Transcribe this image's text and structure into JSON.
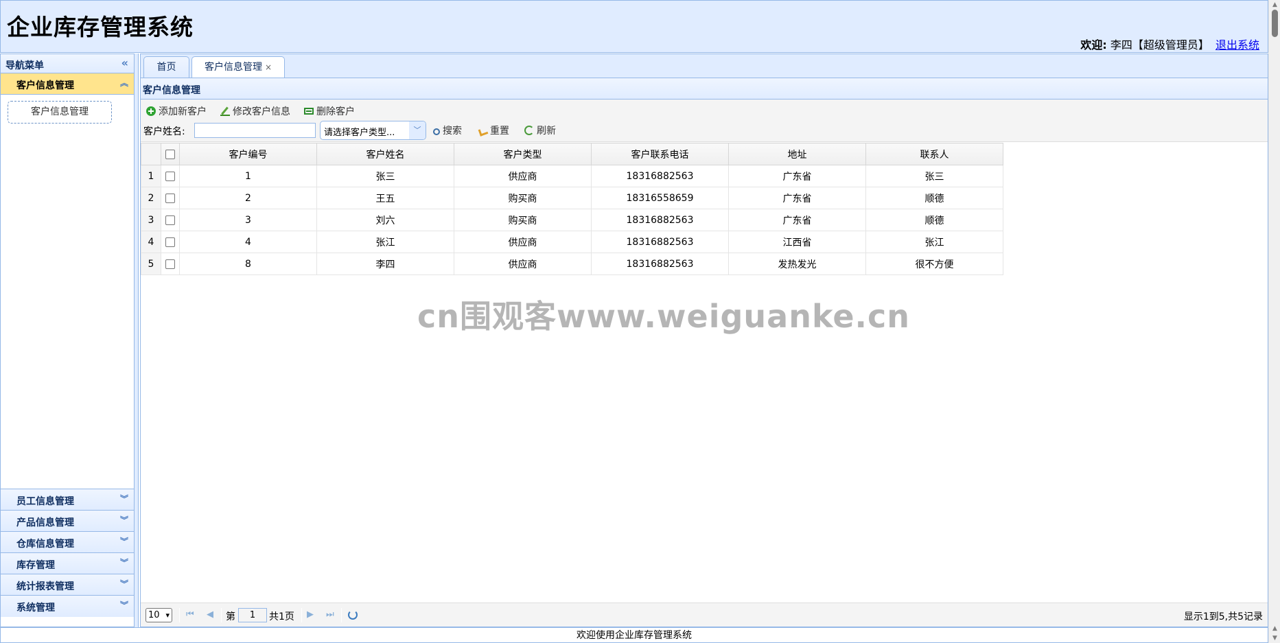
{
  "header": {
    "title": "企业库存管理系统",
    "welcome_label": "欢迎:",
    "user": "李四【超级管理员】",
    "logout": "退出系统"
  },
  "nav": {
    "title": "导航菜单",
    "sections": [
      {
        "label": "客户信息管理",
        "expanded": true,
        "links": [
          "客户信息管理"
        ]
      },
      {
        "label": "员工信息管理"
      },
      {
        "label": "产品信息管理"
      },
      {
        "label": "仓库信息管理"
      },
      {
        "label": "库存管理"
      },
      {
        "label": "统计报表管理"
      },
      {
        "label": "系统管理"
      }
    ]
  },
  "tabs": [
    {
      "label": "首页",
      "active": false
    },
    {
      "label": "客户信息管理",
      "active": true,
      "closable": true
    }
  ],
  "panel": {
    "title": "客户信息管理",
    "toolbar": {
      "add": "添加新客户",
      "edit": "修改客户信息",
      "remove": "删除客户",
      "name_label": "客户姓名:",
      "name_value": "",
      "type_placeholder": "请选择客户类型...",
      "search": "搜索",
      "reset": "重置",
      "refresh": "刷新"
    },
    "grid": {
      "columns": [
        "客户编号",
        "客户姓名",
        "客户类型",
        "客户联系电话",
        "地址",
        "联系人"
      ],
      "rows": [
        {
          "num": "1",
          "cells": [
            "1",
            "张三",
            "供应商",
            "18316882563",
            "广东省",
            "张三"
          ]
        },
        {
          "num": "2",
          "cells": [
            "2",
            "王五",
            "购买商",
            "18316558659",
            "广东省",
            "顺德"
          ]
        },
        {
          "num": "3",
          "cells": [
            "3",
            "刘六",
            "购买商",
            "18316882563",
            "广东省",
            "顺德"
          ]
        },
        {
          "num": "4",
          "cells": [
            "4",
            "张江",
            "供应商",
            "18316882563",
            "江西省",
            "张江"
          ]
        },
        {
          "num": "5",
          "cells": [
            "8",
            "李四",
            "供应商",
            "18316882563",
            "发热发光",
            "很不方便"
          ]
        }
      ]
    },
    "pager": {
      "page_size": "10",
      "page_prefix": "第",
      "page_number": "1",
      "page_total": "共1页",
      "info": "显示1到5,共5记录"
    }
  },
  "watermark": "cn围观客www.weiguanke.cn",
  "footer": "欢迎使用企业库存管理系统"
}
